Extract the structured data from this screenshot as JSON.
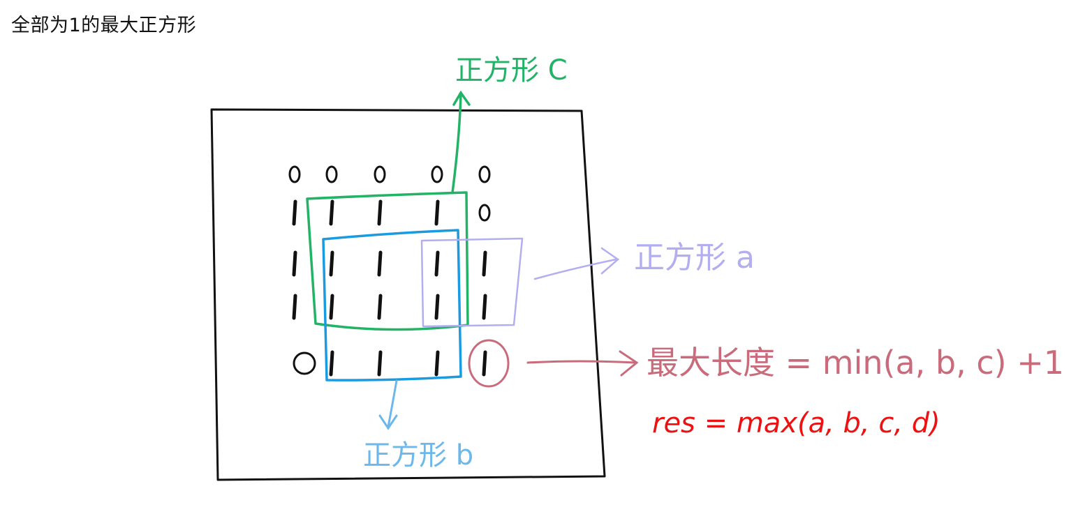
{
  "title": "全部为1的最大正方形",
  "colors": {
    "ink": "#111111",
    "square_c": "#22b366",
    "square_b": "#1a9be0",
    "square_a": "#b2aef0",
    "length_formula": "#c96b7a",
    "result_formula": "#ee1111"
  },
  "grid": [
    [
      "0",
      "0",
      "0",
      "0",
      "0"
    ],
    [
      "1",
      "1",
      "1",
      "1",
      "0"
    ],
    [
      "1",
      "1",
      "1",
      "1",
      "1"
    ],
    [
      "1",
      "1",
      "1",
      "1",
      "1"
    ],
    [
      "0",
      "1",
      "1",
      "1",
      "1"
    ]
  ],
  "labels": {
    "square_c": "正方形 C",
    "square_a": "正方形 a",
    "square_b": "正方形 b",
    "max_length": "最大长度 = min(a, b, c) +1",
    "result": "res = max(a, b, c, d)"
  }
}
